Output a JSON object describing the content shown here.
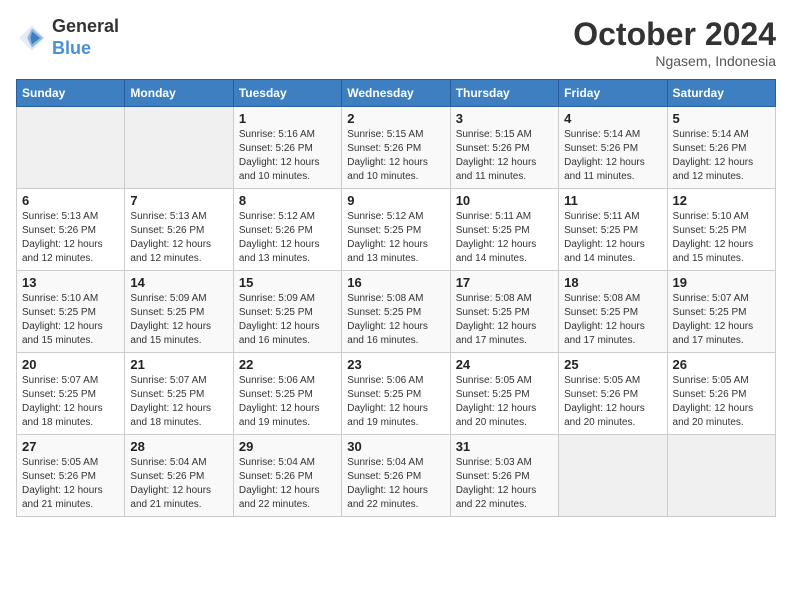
{
  "header": {
    "logo_text_general": "General",
    "logo_text_blue": "Blue",
    "month": "October 2024",
    "location": "Ngasem, Indonesia"
  },
  "calendar": {
    "days_of_week": [
      "Sunday",
      "Monday",
      "Tuesday",
      "Wednesday",
      "Thursday",
      "Friday",
      "Saturday"
    ],
    "weeks": [
      [
        {
          "day": "",
          "info": ""
        },
        {
          "day": "",
          "info": ""
        },
        {
          "day": "1",
          "info": "Sunrise: 5:16 AM\nSunset: 5:26 PM\nDaylight: 12 hours\nand 10 minutes."
        },
        {
          "day": "2",
          "info": "Sunrise: 5:15 AM\nSunset: 5:26 PM\nDaylight: 12 hours\nand 10 minutes."
        },
        {
          "day": "3",
          "info": "Sunrise: 5:15 AM\nSunset: 5:26 PM\nDaylight: 12 hours\nand 11 minutes."
        },
        {
          "day": "4",
          "info": "Sunrise: 5:14 AM\nSunset: 5:26 PM\nDaylight: 12 hours\nand 11 minutes."
        },
        {
          "day": "5",
          "info": "Sunrise: 5:14 AM\nSunset: 5:26 PM\nDaylight: 12 hours\nand 12 minutes."
        }
      ],
      [
        {
          "day": "6",
          "info": "Sunrise: 5:13 AM\nSunset: 5:26 PM\nDaylight: 12 hours\nand 12 minutes."
        },
        {
          "day": "7",
          "info": "Sunrise: 5:13 AM\nSunset: 5:26 PM\nDaylight: 12 hours\nand 12 minutes."
        },
        {
          "day": "8",
          "info": "Sunrise: 5:12 AM\nSunset: 5:26 PM\nDaylight: 12 hours\nand 13 minutes."
        },
        {
          "day": "9",
          "info": "Sunrise: 5:12 AM\nSunset: 5:25 PM\nDaylight: 12 hours\nand 13 minutes."
        },
        {
          "day": "10",
          "info": "Sunrise: 5:11 AM\nSunset: 5:25 PM\nDaylight: 12 hours\nand 14 minutes."
        },
        {
          "day": "11",
          "info": "Sunrise: 5:11 AM\nSunset: 5:25 PM\nDaylight: 12 hours\nand 14 minutes."
        },
        {
          "day": "12",
          "info": "Sunrise: 5:10 AM\nSunset: 5:25 PM\nDaylight: 12 hours\nand 15 minutes."
        }
      ],
      [
        {
          "day": "13",
          "info": "Sunrise: 5:10 AM\nSunset: 5:25 PM\nDaylight: 12 hours\nand 15 minutes."
        },
        {
          "day": "14",
          "info": "Sunrise: 5:09 AM\nSunset: 5:25 PM\nDaylight: 12 hours\nand 15 minutes."
        },
        {
          "day": "15",
          "info": "Sunrise: 5:09 AM\nSunset: 5:25 PM\nDaylight: 12 hours\nand 16 minutes."
        },
        {
          "day": "16",
          "info": "Sunrise: 5:08 AM\nSunset: 5:25 PM\nDaylight: 12 hours\nand 16 minutes."
        },
        {
          "day": "17",
          "info": "Sunrise: 5:08 AM\nSunset: 5:25 PM\nDaylight: 12 hours\nand 17 minutes."
        },
        {
          "day": "18",
          "info": "Sunrise: 5:08 AM\nSunset: 5:25 PM\nDaylight: 12 hours\nand 17 minutes."
        },
        {
          "day": "19",
          "info": "Sunrise: 5:07 AM\nSunset: 5:25 PM\nDaylight: 12 hours\nand 17 minutes."
        }
      ],
      [
        {
          "day": "20",
          "info": "Sunrise: 5:07 AM\nSunset: 5:25 PM\nDaylight: 12 hours\nand 18 minutes."
        },
        {
          "day": "21",
          "info": "Sunrise: 5:07 AM\nSunset: 5:25 PM\nDaylight: 12 hours\nand 18 minutes."
        },
        {
          "day": "22",
          "info": "Sunrise: 5:06 AM\nSunset: 5:25 PM\nDaylight: 12 hours\nand 19 minutes."
        },
        {
          "day": "23",
          "info": "Sunrise: 5:06 AM\nSunset: 5:25 PM\nDaylight: 12 hours\nand 19 minutes."
        },
        {
          "day": "24",
          "info": "Sunrise: 5:05 AM\nSunset: 5:25 PM\nDaylight: 12 hours\nand 20 minutes."
        },
        {
          "day": "25",
          "info": "Sunrise: 5:05 AM\nSunset: 5:26 PM\nDaylight: 12 hours\nand 20 minutes."
        },
        {
          "day": "26",
          "info": "Sunrise: 5:05 AM\nSunset: 5:26 PM\nDaylight: 12 hours\nand 20 minutes."
        }
      ],
      [
        {
          "day": "27",
          "info": "Sunrise: 5:05 AM\nSunset: 5:26 PM\nDaylight: 12 hours\nand 21 minutes."
        },
        {
          "day": "28",
          "info": "Sunrise: 5:04 AM\nSunset: 5:26 PM\nDaylight: 12 hours\nand 21 minutes."
        },
        {
          "day": "29",
          "info": "Sunrise: 5:04 AM\nSunset: 5:26 PM\nDaylight: 12 hours\nand 22 minutes."
        },
        {
          "day": "30",
          "info": "Sunrise: 5:04 AM\nSunset: 5:26 PM\nDaylight: 12 hours\nand 22 minutes."
        },
        {
          "day": "31",
          "info": "Sunrise: 5:03 AM\nSunset: 5:26 PM\nDaylight: 12 hours\nand 22 minutes."
        },
        {
          "day": "",
          "info": ""
        },
        {
          "day": "",
          "info": ""
        }
      ]
    ]
  }
}
